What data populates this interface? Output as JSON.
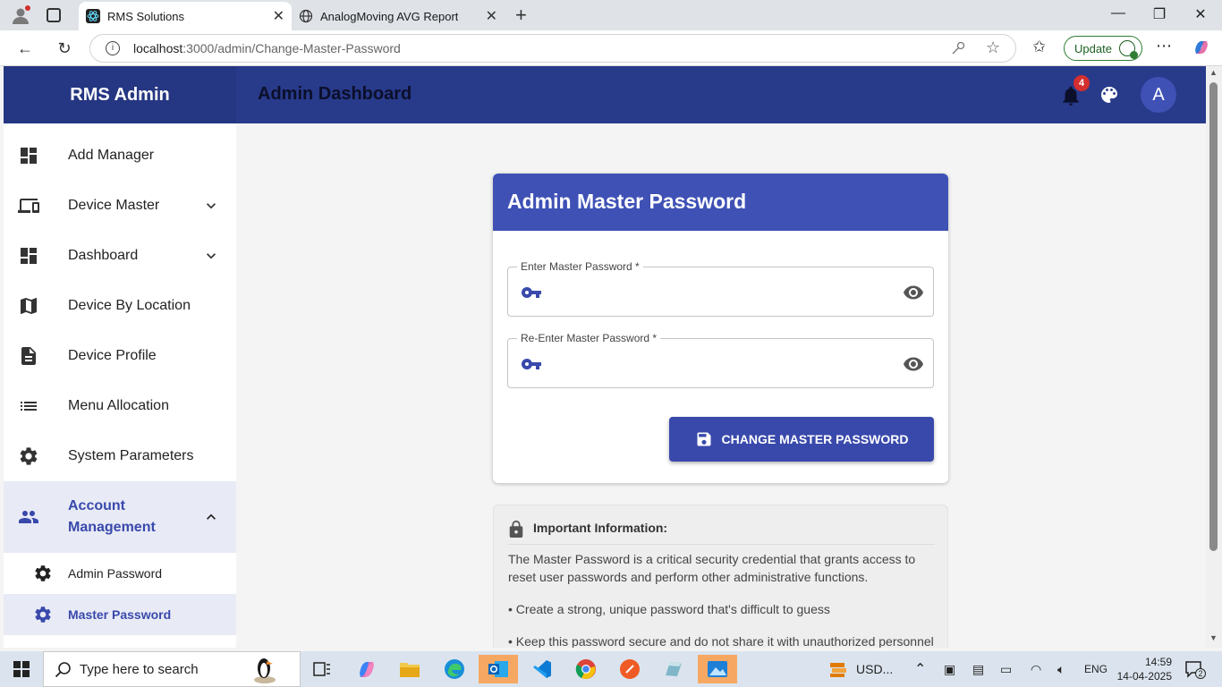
{
  "browser": {
    "tabs": [
      {
        "title": "RMS Solutions",
        "active": true
      },
      {
        "title": "AnalogMoving AVG Report",
        "active": false
      }
    ],
    "url_host": "localhost",
    "url_path": ":3000/admin/Change-Master-Password",
    "update_label": "Update"
  },
  "app": {
    "brand": "RMS Admin",
    "title": "Admin Dashboard",
    "notification_count": "4",
    "avatar_letter": "A",
    "accent_color": "#3f51b5",
    "appbar_color": "#283a8a"
  },
  "sidebar": {
    "items": [
      {
        "label": "Add Manager",
        "icon": "dashboard-icon"
      },
      {
        "label": "Device Master",
        "icon": "devices-icon",
        "chevron": "down"
      },
      {
        "label": "Dashboard",
        "icon": "dashboard-icon",
        "chevron": "down"
      },
      {
        "label": "Device By Location",
        "icon": "map-icon"
      },
      {
        "label": "Device Profile",
        "icon": "document-icon"
      },
      {
        "label": "Menu Allocation",
        "icon": "list-icon"
      },
      {
        "label": "System Parameters",
        "icon": "gear-icon"
      },
      {
        "label": "Account Management",
        "icon": "people-icon",
        "chevron": "up",
        "expanded": true
      }
    ],
    "sub_items": [
      {
        "label": "Admin Password",
        "icon": "gear-icon"
      },
      {
        "label": "Master Password",
        "icon": "gear-icon",
        "selected": true
      }
    ]
  },
  "form": {
    "title": "Admin Master Password",
    "field1_label": "Enter Master Password *",
    "field1_value": "",
    "field2_label": "Re-Enter Master Password *",
    "field2_value": "",
    "button_label": "CHANGE MASTER PASSWORD"
  },
  "info": {
    "title": "Important Information:",
    "paragraph_1": "The Master Password is a critical security credential that grants access to reset user passwords and perform other administrative functions.",
    "bullet_1": "• Create a strong, unique password that's difficult to guess",
    "bullet_2": "• Keep this password secure and do not share it with unauthorized personnel"
  },
  "taskbar": {
    "search_placeholder": "Type here to search",
    "currency": "USD...",
    "language": "ENG",
    "time": "14:59",
    "date": "14-04-2025",
    "notifications": "2"
  }
}
